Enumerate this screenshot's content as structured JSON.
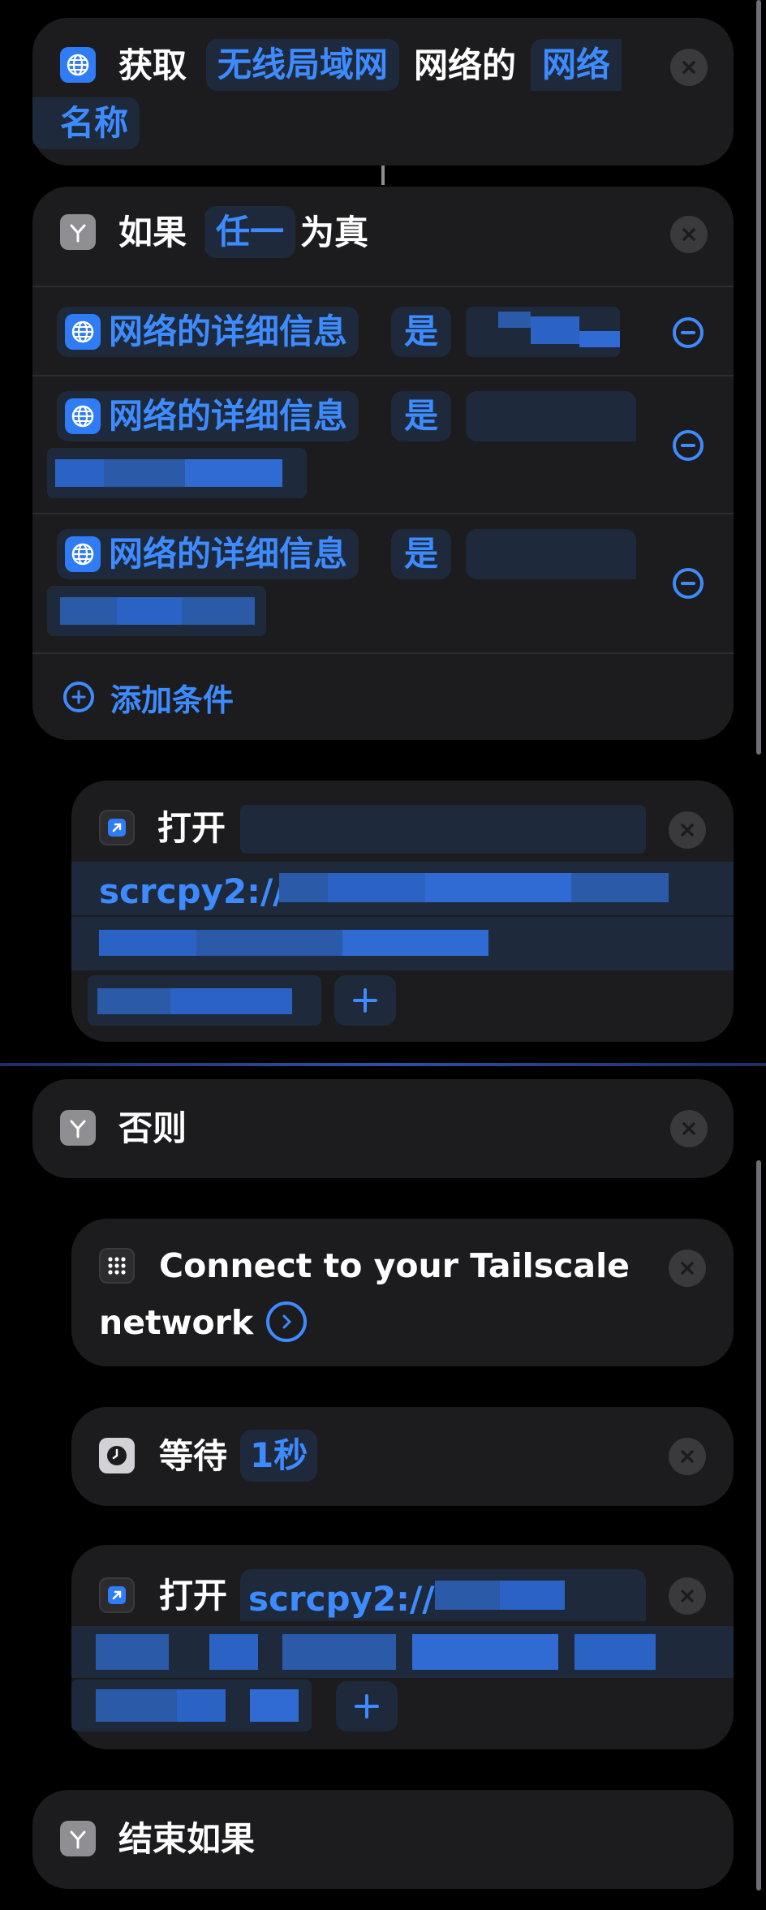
{
  "get_network": {
    "verb": "获取",
    "type_token": "无线局域网",
    "mid": "网络的",
    "prop_token_1": "网络",
    "prop_token_2": "名称"
  },
  "if_block": {
    "word": "如果",
    "mode_token": "任一",
    "suffix": "为真",
    "conditions": [
      {
        "field": "网络的详细信息",
        "op": "是"
      },
      {
        "field": "网络的详细信息",
        "op": "是"
      },
      {
        "field": "网络的详细信息",
        "op": "是"
      }
    ],
    "add_condition": "添加条件"
  },
  "open_url_1": {
    "verb": "打开",
    "url_start": "scrcpy2://"
  },
  "otherwise": {
    "label": "否则"
  },
  "tailscale": {
    "line1": "Connect to your Tailscale",
    "line2": "network"
  },
  "wait": {
    "verb": "等待",
    "duration": "1秒"
  },
  "open_url_2": {
    "verb": "打开",
    "url_start": "scrcpy2://"
  },
  "end_if": {
    "label": "结束如果"
  },
  "icons": {
    "globe": "globe-icon",
    "branch": "branch-icon",
    "open": "open-app-icon",
    "grid": "shortcut-grid-icon",
    "clock": "clock-icon",
    "close": "close-icon",
    "plus": "plus-icon",
    "minus": "remove-circle-icon",
    "chevron": "chevron-right-circle-icon"
  },
  "colors": {
    "accent": "#3d8bff",
    "card": "#1c1c1e",
    "token_bg": "#1e2a3c",
    "background": "#000000"
  }
}
